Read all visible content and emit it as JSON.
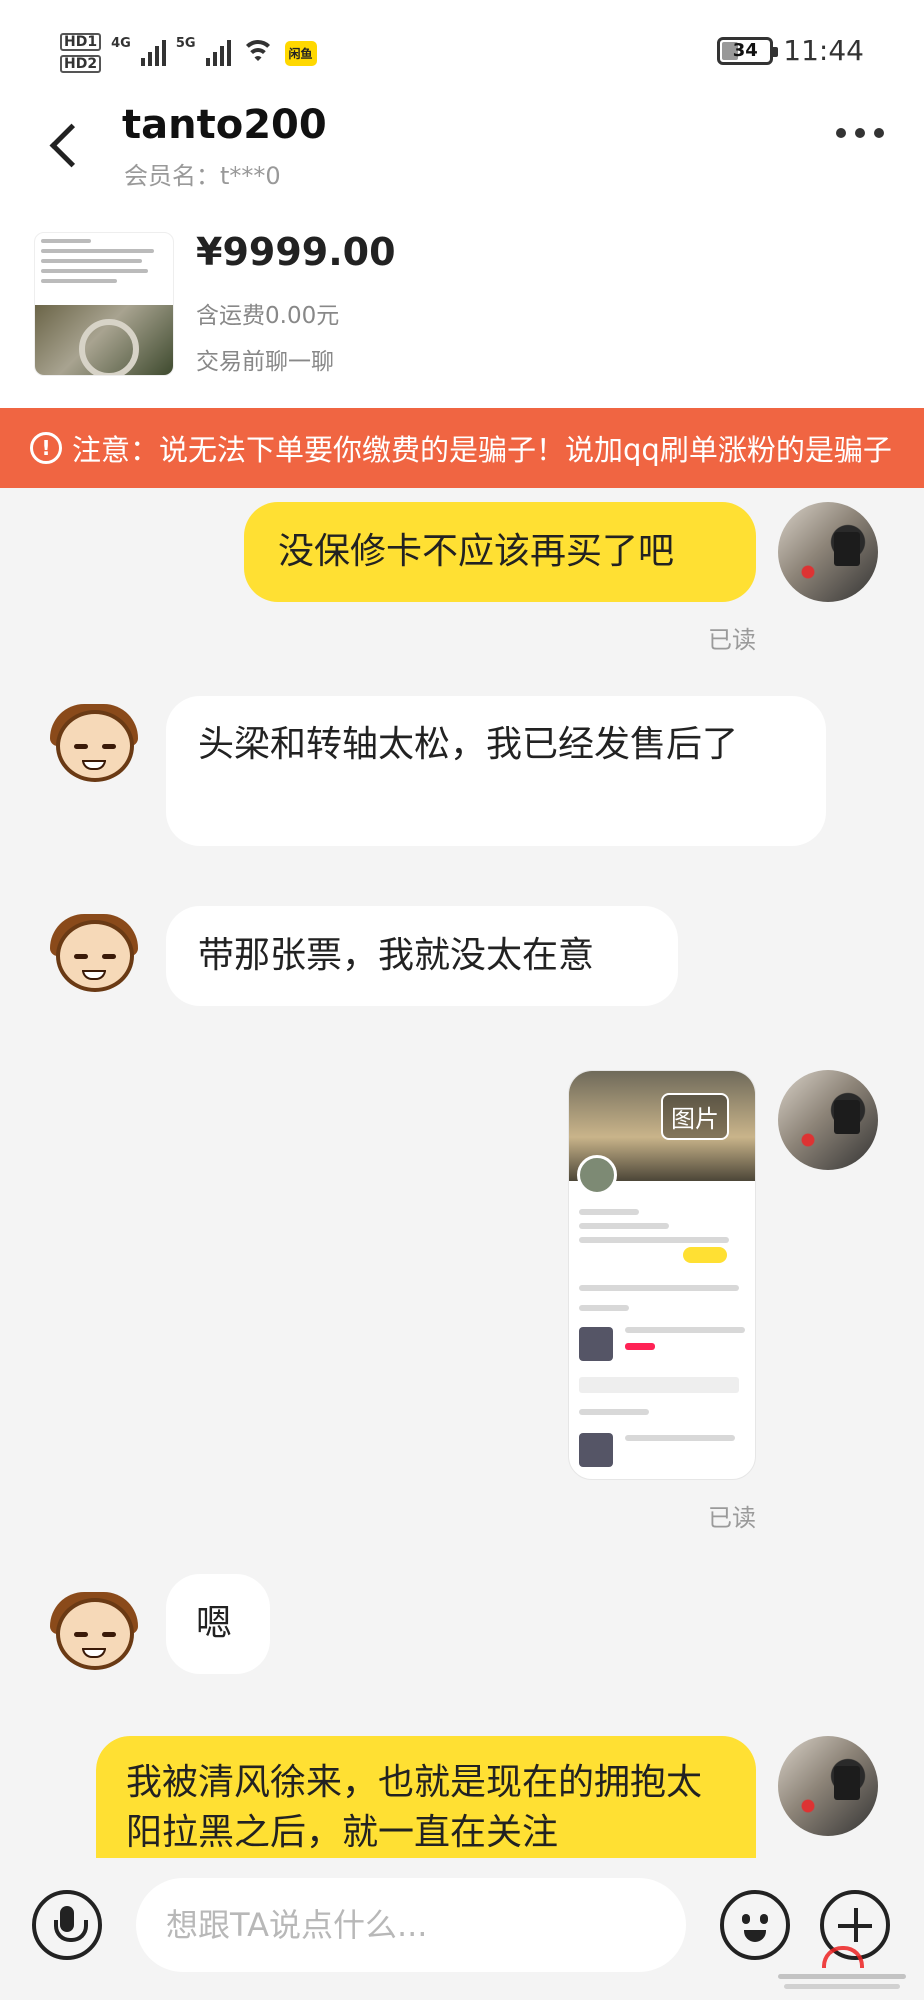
{
  "status_bar": {
    "hd1": "HD1",
    "hd2": "HD2",
    "net1": "4G",
    "net2": "5G",
    "app_badge": "闲鱼",
    "battery": "34",
    "battery_level": 0.34,
    "time": "11:44",
    "icons": [
      "signal-icon",
      "wifi-icon",
      "battery-icon"
    ]
  },
  "header": {
    "title": "tanto200",
    "member_name": "会员名：t***0",
    "icons": [
      "back-icon",
      "more-icon"
    ]
  },
  "product": {
    "price": "¥9999.00",
    "shipping": "含运费0.00元",
    "prechat": "交易前聊一聊"
  },
  "warning": {
    "icon": "exclamation",
    "text": "注意：说无法下单要你缴费的是骗子！说加qq刷单涨粉的是骗子"
  },
  "messages": [
    {
      "side": "out",
      "text": "没保修卡不应该再买了吧",
      "status": "已读"
    },
    {
      "side": "in",
      "text": "头梁和转轴太松，我已经发售后了"
    },
    {
      "side": "in",
      "text": "带那张票，我就没太在意"
    },
    {
      "side": "out",
      "type": "image",
      "label": "图片",
      "status": "已读"
    },
    {
      "side": "in",
      "text": "嗯"
    },
    {
      "side": "out",
      "text": "我被清风徐来，也就是现在的拥抱太阳拉黑之后，就一直在关注"
    }
  ],
  "input_bar": {
    "placeholder": "想跟TA说点什么...",
    "icons": [
      "microphone-icon",
      "emoji-icon",
      "plus-icon"
    ]
  },
  "colors": {
    "accent_yellow": "#ffe033",
    "warning_orange": "#f06542",
    "background": "#f4f4f4"
  }
}
